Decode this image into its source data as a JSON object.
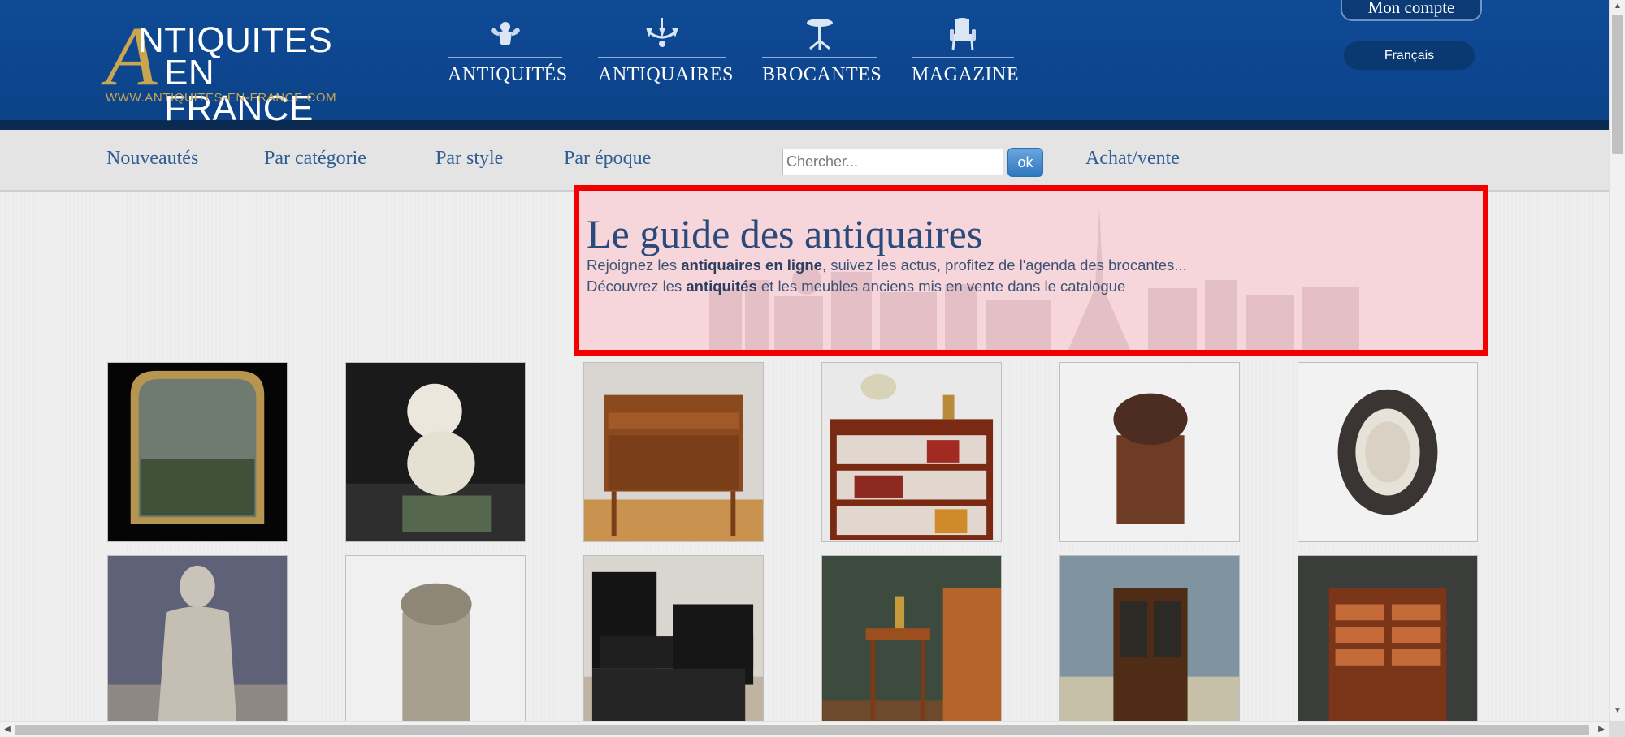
{
  "header": {
    "logo": {
      "big_letter": "A",
      "line1": "NTIQUITES",
      "line2": "EN FRANCE",
      "url": "WWW.ANTIQUITES-EN-FRANCE.COM"
    },
    "main_nav": [
      {
        "label": "ANTIQUITÉS",
        "icon": "cherub-icon"
      },
      {
        "label": "ANTIQUAIRES",
        "icon": "chandelier-icon"
      },
      {
        "label": "BROCANTES",
        "icon": "pedestal-table-icon"
      },
      {
        "label": "MAGAZINE",
        "icon": "armchair-icon"
      }
    ],
    "account_label": "Mon compte",
    "language_label": "Français"
  },
  "subnav": {
    "links": [
      "Nouveautés",
      "Par catégorie",
      "Par style",
      "Par époque"
    ],
    "search_placeholder": "Chercher...",
    "search_button": "ok",
    "buy_sell_link": "Achat/vente"
  },
  "intro": {
    "title": "Le guide des antiquaires",
    "line1_prefix": "Rejoignez les ",
    "line1_bold": "antiquaires en ligne",
    "line1_suffix": ", suivez les actus, profitez de l'agenda des brocantes...",
    "line2_prefix": "Découvrez les ",
    "line2_bold": "antiquités",
    "line2_suffix": " et les meubles anciens mis en vente dans le catalogue"
  },
  "colors": {
    "header_blue": "#0f4a96",
    "gold": "#c9a650",
    "link_blue": "#2f5c92",
    "highlight_red": "#f20000"
  }
}
